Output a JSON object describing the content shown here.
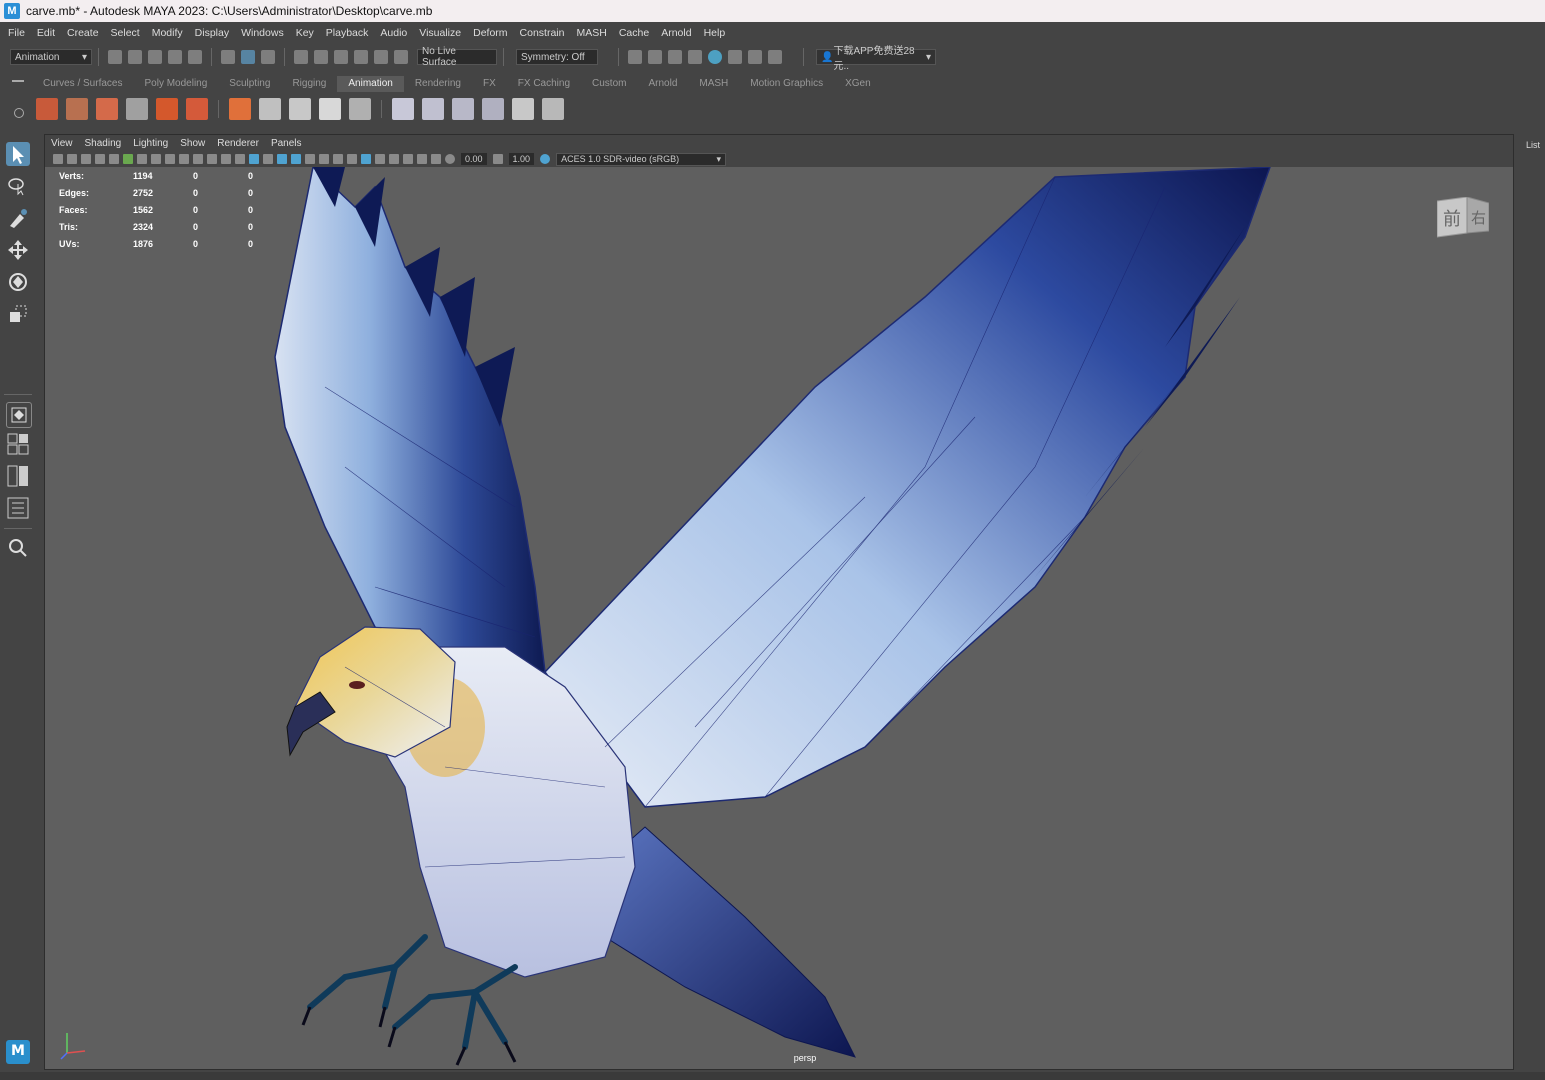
{
  "window": {
    "title": "carve.mb* - Autodesk MAYA 2023: C:\\Users\\Administrator\\Desktop\\carve.mb",
    "app_icon_letter": "M"
  },
  "menubar": {
    "items": [
      "File",
      "Edit",
      "Create",
      "Select",
      "Modify",
      "Display",
      "Windows",
      "Key",
      "Playback",
      "Audio",
      "Visualize",
      "Deform",
      "Constrain",
      "MASH",
      "Cache",
      "Arnold",
      "Help"
    ]
  },
  "status_line": {
    "menuset": "Animation",
    "live_surface": "No Live Surface",
    "symmetry": "Symmetry: Off",
    "promo": "下载APP免费送28元.."
  },
  "shelf": {
    "tabs": [
      "Curves / Surfaces",
      "Poly Modeling",
      "Sculpting",
      "Rigging",
      "Animation",
      "Rendering",
      "FX",
      "FX Caching",
      "Custom",
      "Arnold",
      "MASH",
      "Motion Graphics",
      "XGen"
    ],
    "active_tab": "Animation"
  },
  "viewport": {
    "panel_menus": [
      "View",
      "Shading",
      "Lighting",
      "Show",
      "Renderer",
      "Panels"
    ],
    "exposure": "0.00",
    "gamma": "1.00",
    "color_space": "ACES 1.0 SDR-video (sRGB)",
    "camera": "persp",
    "viewcube": {
      "front": "前",
      "right": "右"
    },
    "hud": [
      {
        "label": "Verts:",
        "v1": "1194",
        "v2": "0",
        "v3": "0"
      },
      {
        "label": "Edges:",
        "v1": "2752",
        "v2": "0",
        "v3": "0"
      },
      {
        "label": "Faces:",
        "v1": "1562",
        "v2": "0",
        "v3": "0"
      },
      {
        "label": "Tris:",
        "v1": "2324",
        "v2": "0",
        "v3": "0"
      },
      {
        "label": "UVs:",
        "v1": "1876",
        "v2": "0",
        "v3": "0"
      }
    ]
  },
  "right_panel": {
    "label": "List"
  },
  "logo": {
    "letter": "M"
  },
  "colors": {
    "ui_bg": "#444444",
    "viewport_bg": "#5f5f5f",
    "accent_blue": "#2b8fd6",
    "wing_dark": "#1a2a6a",
    "wing_light": "#dde6f3",
    "head_yellow": "#e6b84a"
  }
}
